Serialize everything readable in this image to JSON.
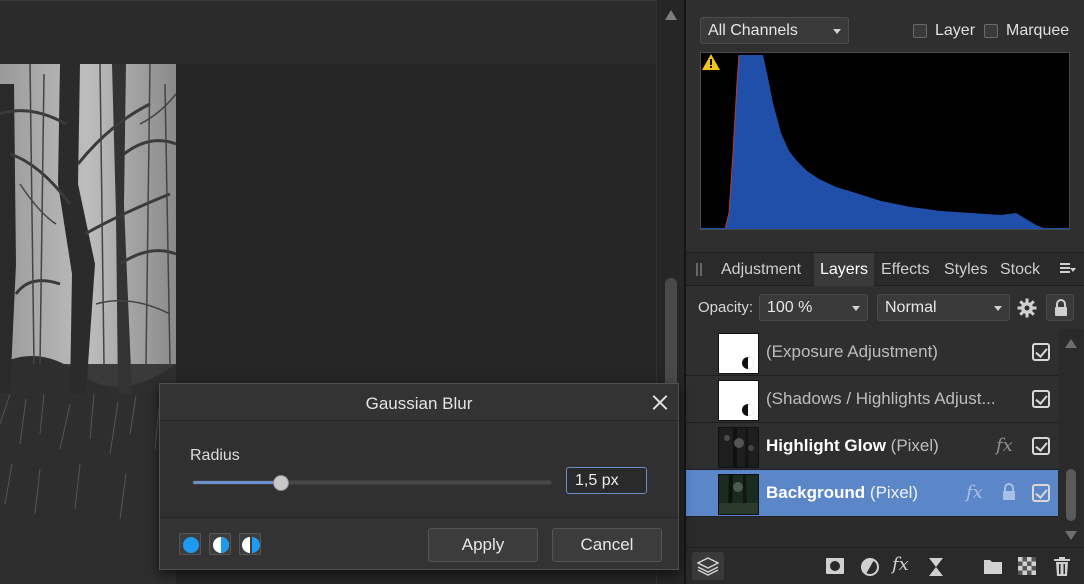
{
  "histogram": {
    "channel": "All Channels",
    "layer_label": "Layer",
    "marquee_label": "Marquee",
    "warning_icon": "warning-icon",
    "colors": {
      "fill": "#1f4fa8",
      "edge": "#c0392b",
      "background": "#000000"
    }
  },
  "tabs": [
    {
      "label": "Adjustment",
      "active": false
    },
    {
      "label": "Layers",
      "active": true
    },
    {
      "label": "Effects",
      "active": false
    },
    {
      "label": "Styles",
      "active": false
    },
    {
      "label": "Stock",
      "active": false
    }
  ],
  "layers_panel": {
    "opacity_label": "Opacity:",
    "opacity_value": "100 %",
    "blend_mode": "Normal",
    "layers": [
      {
        "name": "(Exposure Adjustment)",
        "kind": "",
        "bold": false,
        "thumb": "white-adjustment",
        "fx": false,
        "locked": false,
        "visible": true,
        "selected": false
      },
      {
        "name": "(Shadows / Highlights Adjust...",
        "kind": "",
        "bold": false,
        "thumb": "white-adjustment",
        "fx": false,
        "locked": false,
        "visible": true,
        "selected": false
      },
      {
        "name": "Highlight Glow",
        "kind": "(Pixel)",
        "bold": true,
        "thumb": "dark-photo",
        "fx": true,
        "locked": false,
        "visible": true,
        "selected": false
      },
      {
        "name": "Background",
        "kind": "(Pixel)",
        "bold": true,
        "thumb": "dark-photo",
        "fx": true,
        "locked": true,
        "visible": true,
        "selected": true
      }
    ],
    "fx_symbol": "fx"
  },
  "gaussian_blur": {
    "title": "Gaussian Blur",
    "radius_label": "Radius",
    "radius_value": "1,5 px",
    "slider_fraction": 0.245,
    "apply_label": "Apply",
    "cancel_label": "Cancel",
    "accent": "#6b8fc9"
  }
}
